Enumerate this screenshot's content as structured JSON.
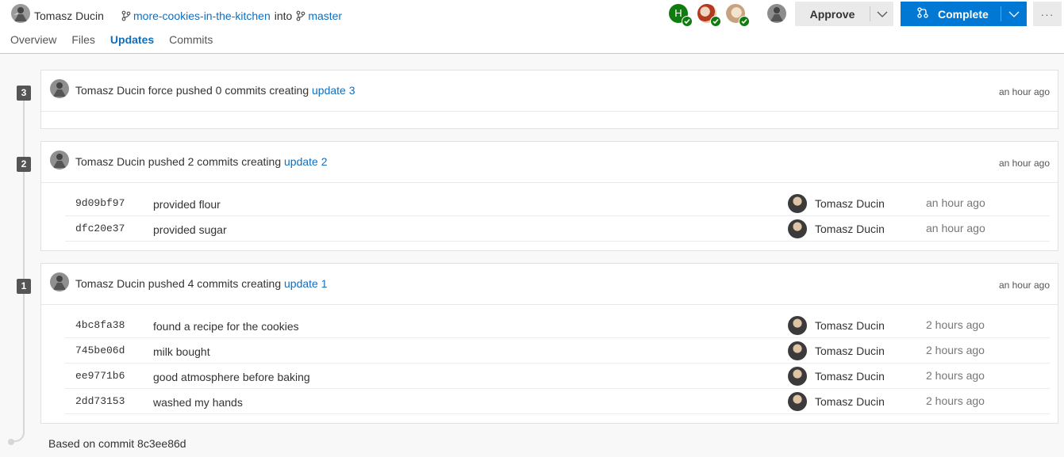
{
  "header": {
    "author_name": "Tomasz Ducin",
    "source_branch": "more-cookies-in-the-kitchen",
    "into_text": "into",
    "target_branch": "master",
    "tabs": [
      {
        "label": "Overview"
      },
      {
        "label": "Files"
      },
      {
        "label": "Updates"
      },
      {
        "label": "Commits"
      }
    ],
    "reviewer_initial": "H",
    "approve_label": "Approve",
    "complete_label": "Complete",
    "more_label": "···"
  },
  "colors": {
    "accent": "#0078d4",
    "link": "#106ebe",
    "approved": "#107c10"
  },
  "updates": [
    {
      "number": "3",
      "title_prefix": "Tomasz Ducin force pushed 0 commits creating",
      "link": "update 3",
      "time": "an hour ago",
      "commits": []
    },
    {
      "number": "2",
      "title_prefix": "Tomasz Ducin pushed 2 commits creating",
      "link": "update 2",
      "time": "an hour ago",
      "commits": [
        {
          "hash": "9d09bf97",
          "message": "provided flour",
          "author": "Tomasz Ducin",
          "time": "an hour ago"
        },
        {
          "hash": "dfc20e37",
          "message": "provided sugar",
          "author": "Tomasz Ducin",
          "time": "an hour ago"
        }
      ]
    },
    {
      "number": "1",
      "title_prefix": "Tomasz Ducin pushed 4 commits creating",
      "link": "update 1",
      "time": "an hour ago",
      "commits": [
        {
          "hash": "4bc8fa38",
          "message": "found a recipe for the cookies",
          "author": "Tomasz Ducin",
          "time": "2 hours ago"
        },
        {
          "hash": "745be06d",
          "message": "milk bought",
          "author": "Tomasz Ducin",
          "time": "2 hours ago"
        },
        {
          "hash": "ee9771b6",
          "message": "good atmosphere before baking",
          "author": "Tomasz Ducin",
          "time": "2 hours ago"
        },
        {
          "hash": "2dd73153",
          "message": "washed my hands",
          "author": "Tomasz Ducin",
          "time": "2 hours ago"
        }
      ]
    }
  ],
  "based_on": "Based on commit 8c3ee86d"
}
